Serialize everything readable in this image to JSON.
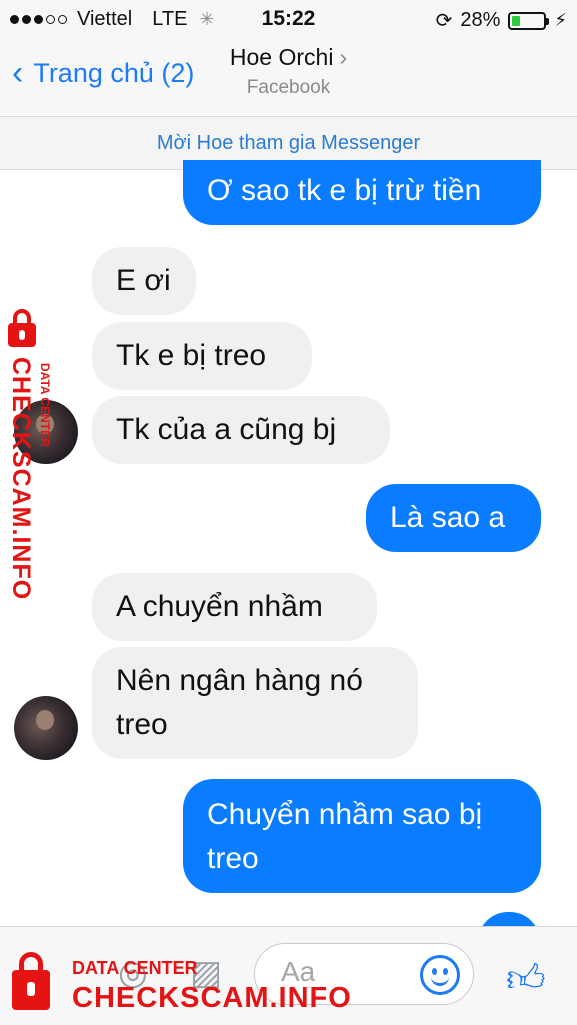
{
  "status_bar": {
    "carrier": "Viettel",
    "network": "LTE",
    "time": "15:22",
    "battery": "28%",
    "battery_level": 0.28
  },
  "header": {
    "back_label": "Trang chủ (2)",
    "contact_name": "Hoe Orchi",
    "contact_sub": "Facebook"
  },
  "invite_bar": {
    "text": "Mời Hoe tham gia Messenger"
  },
  "messages": [
    {
      "from": "me",
      "text": "Ơ sao tk e bị trừ tiền"
    },
    {
      "from": "them",
      "text": "E ơi"
    },
    {
      "from": "them",
      "text": "Tk e bị treo"
    },
    {
      "from": "them",
      "text": "Tk của a cũng bj"
    },
    {
      "from": "me",
      "text": "Là sao a"
    },
    {
      "from": "them",
      "text": "A chuyển nhầm"
    },
    {
      "from": "them",
      "text": "Nên ngân hàng nó treo"
    },
    {
      "from": "me",
      "text": "Chuyển nhầm sao bị treo"
    }
  ],
  "composer": {
    "placeholder": "Aa",
    "icons": [
      "camera-icon",
      "photo-icon",
      "emoji-icon",
      "like-icon"
    ]
  },
  "watermark": {
    "small_text": "DATA CENTER",
    "big_text": "CHECKSCAM.INFO",
    "color": "#e41414"
  },
  "colors": {
    "accent": "#0a7cff",
    "incoming_bubble": "#f0f0f0"
  }
}
